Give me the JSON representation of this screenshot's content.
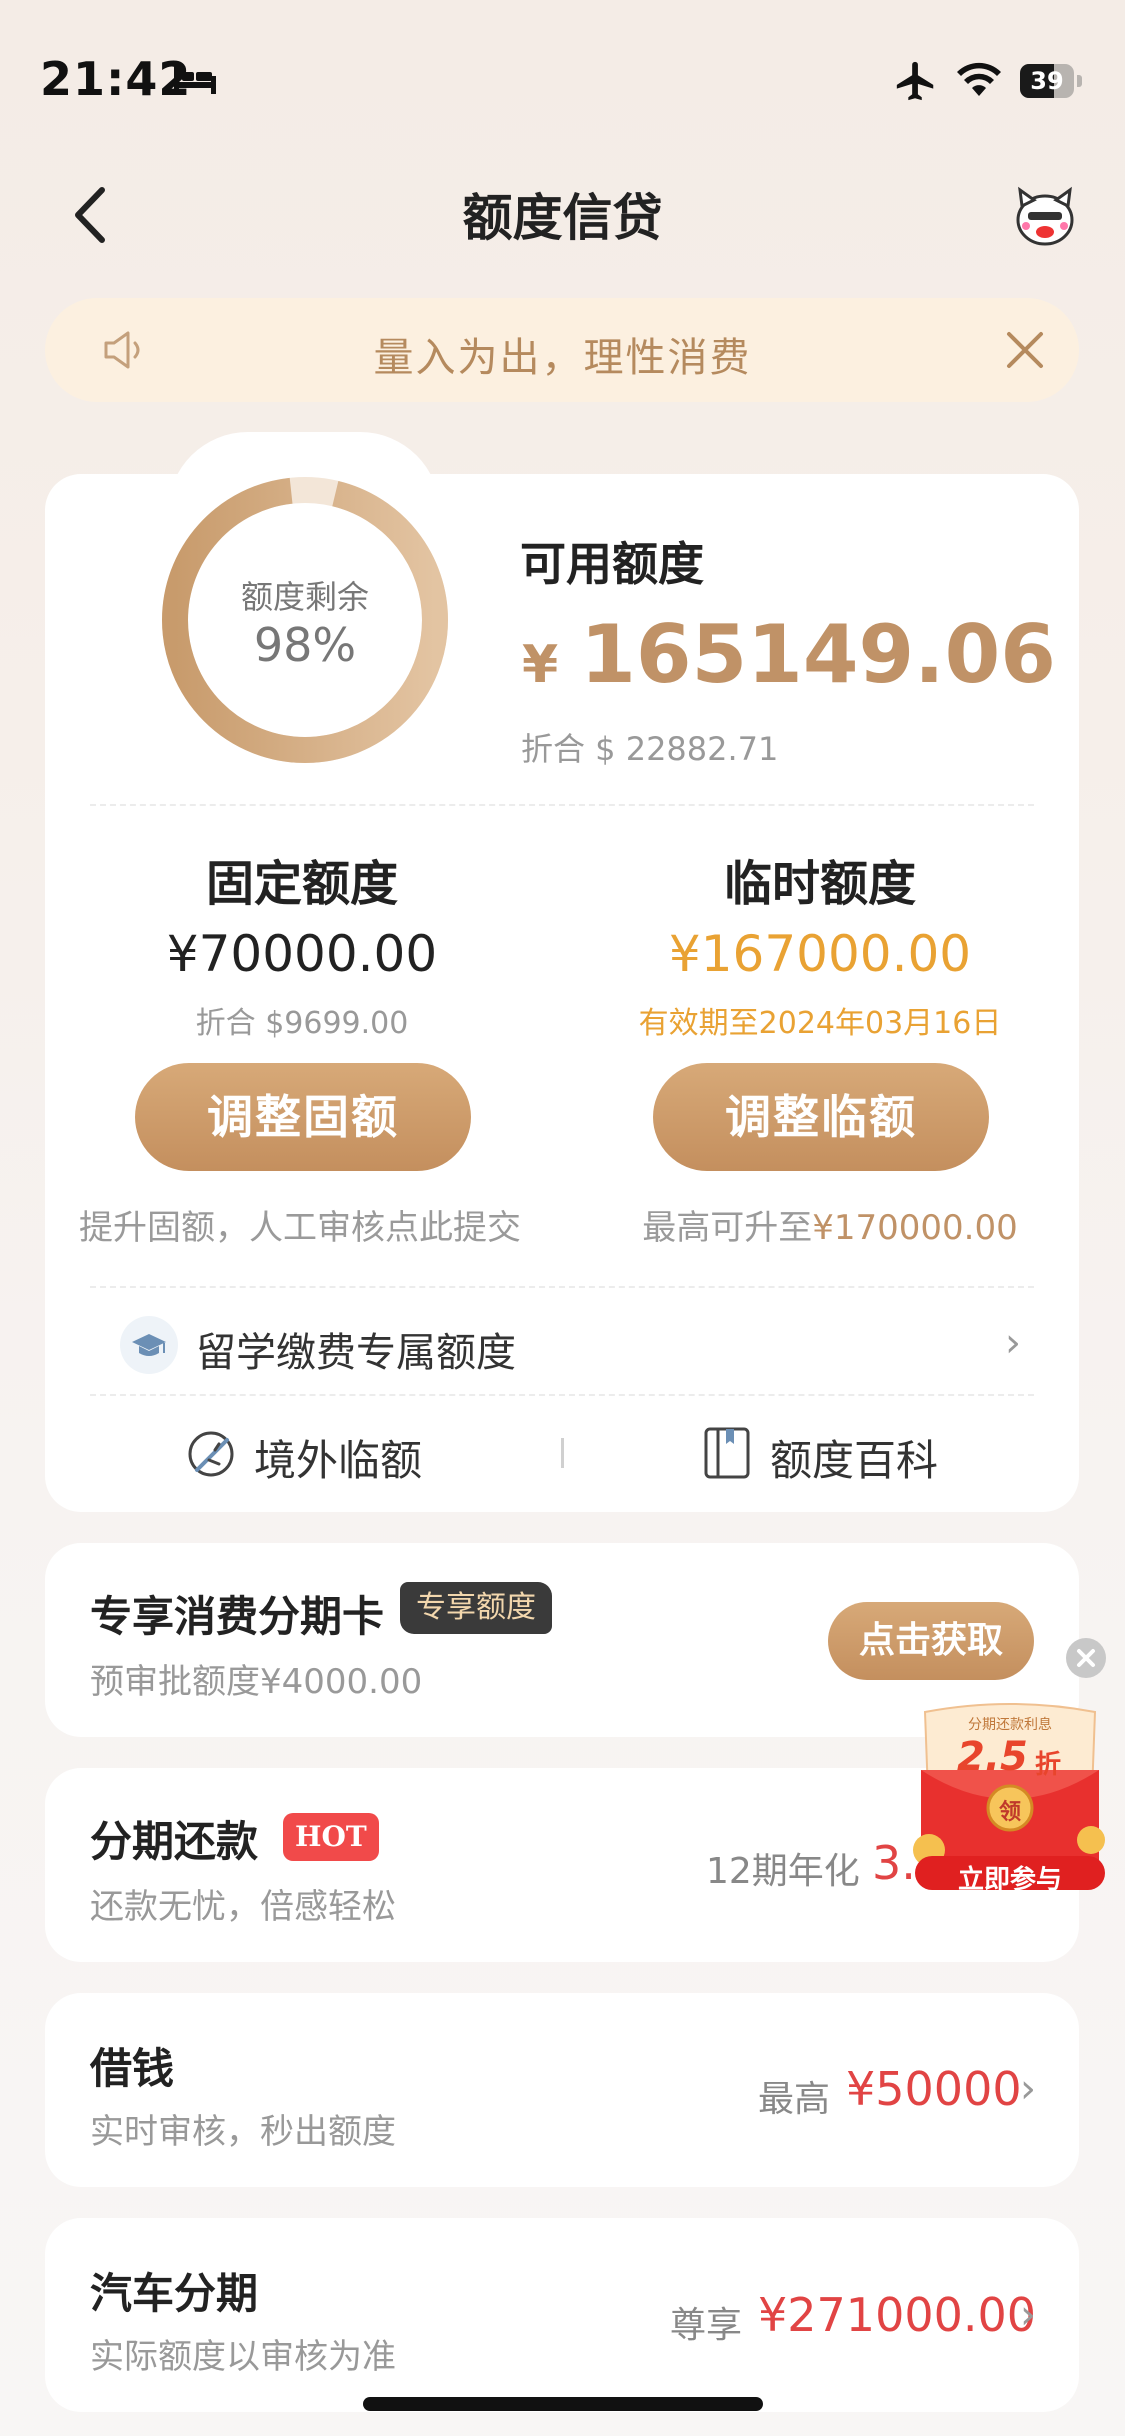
{
  "status_bar": {
    "time": "21:42",
    "battery": "39"
  },
  "nav": {
    "title": "额度信贷"
  },
  "notice": {
    "text": "量入为出，理性消费"
  },
  "summary": {
    "ring_label": "额度剩余",
    "ring_percent": "98%",
    "ring_fraction": 0.98,
    "available_title": "可用额度",
    "currency": "¥",
    "available_amount": "165149.06",
    "usd_equiv": "折合 $ 22882.71"
  },
  "fixed": {
    "title": "固定额度",
    "amount": "¥70000.00",
    "usd": "折合  $9699.00",
    "button": "调整固额",
    "hint": "提升固额，人工审核点此提交"
  },
  "temp": {
    "title": "临时额度",
    "amount": "¥167000.00",
    "validity": "有效期至2024年03月16日",
    "button": "调整临额",
    "hint_prefix": "最高可升至",
    "hint_amount": "¥170000.00"
  },
  "study": {
    "label": "留学缴费专属额度",
    "chevron": "›"
  },
  "links": {
    "overseas": "境外临额",
    "encyclopedia": "额度百科"
  },
  "installment_card": {
    "title": "专享消费分期卡",
    "tag": "专享额度",
    "sub": "预审批额度¥4000.00",
    "button": "点击获取"
  },
  "installment_repay": {
    "title": "分期还款",
    "tag": "HOT",
    "sub": "还款无忧，倍感轻松",
    "right_label": "12期年化",
    "right_value": "3."
  },
  "borrow": {
    "title": "借钱",
    "sub": "实时审核，秒出额度",
    "right_label": "最高",
    "right_value": "¥50000",
    "chevron": "›"
  },
  "car_loan": {
    "title": "汽车分期",
    "sub": "实际额度以审核为准",
    "right_label": "尊享",
    "right_value": "¥271000.00",
    "chevron": "›"
  },
  "promo": {
    "banner": "分期还款利息",
    "discount": "2.5",
    "discount_unit": "折",
    "coin": "领",
    "cta": "立即参与"
  },
  "colors": {
    "gold": "#c09267",
    "red": "#e14444",
    "amber": "#e9a233"
  }
}
